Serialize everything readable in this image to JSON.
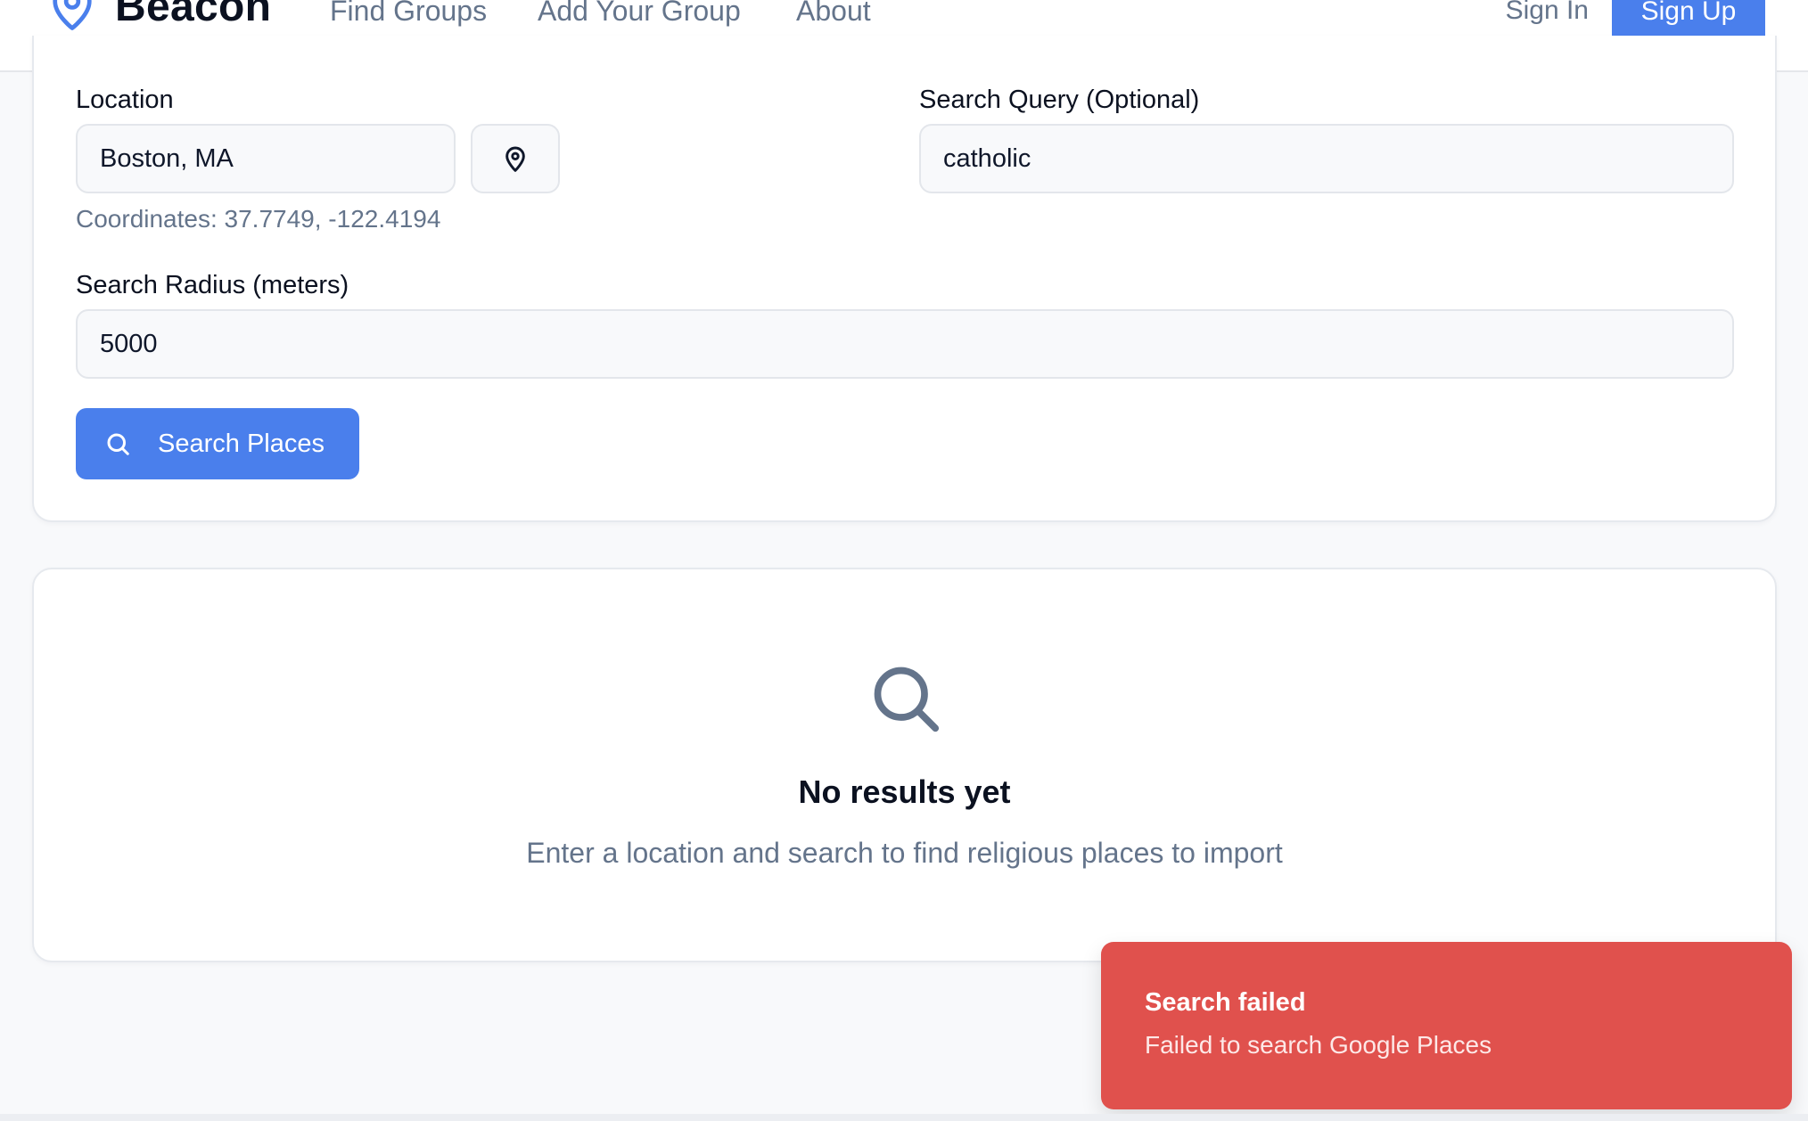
{
  "header": {
    "brand": "Beacon",
    "nav": [
      "Find Groups",
      "Add Your Group",
      "About"
    ],
    "sign_in": "Sign In",
    "sign_up": "Sign Up"
  },
  "form": {
    "location_label": "Location",
    "location_value": "Boston, MA",
    "coordinates": "Coordinates: 37.7749, -122.4194",
    "query_label": "Search Query (Optional)",
    "query_value": "catholic",
    "radius_label": "Search Radius (meters)",
    "radius_value": "5000",
    "search_button": "Search Places"
  },
  "empty_state": {
    "title": "No results yet",
    "description": "Enter a location and search to find religious places to import"
  },
  "toast": {
    "title": "Search failed",
    "message": "Failed to search Google Places"
  },
  "colors": {
    "accent": "#4a7fec",
    "error": "#e0514d"
  }
}
